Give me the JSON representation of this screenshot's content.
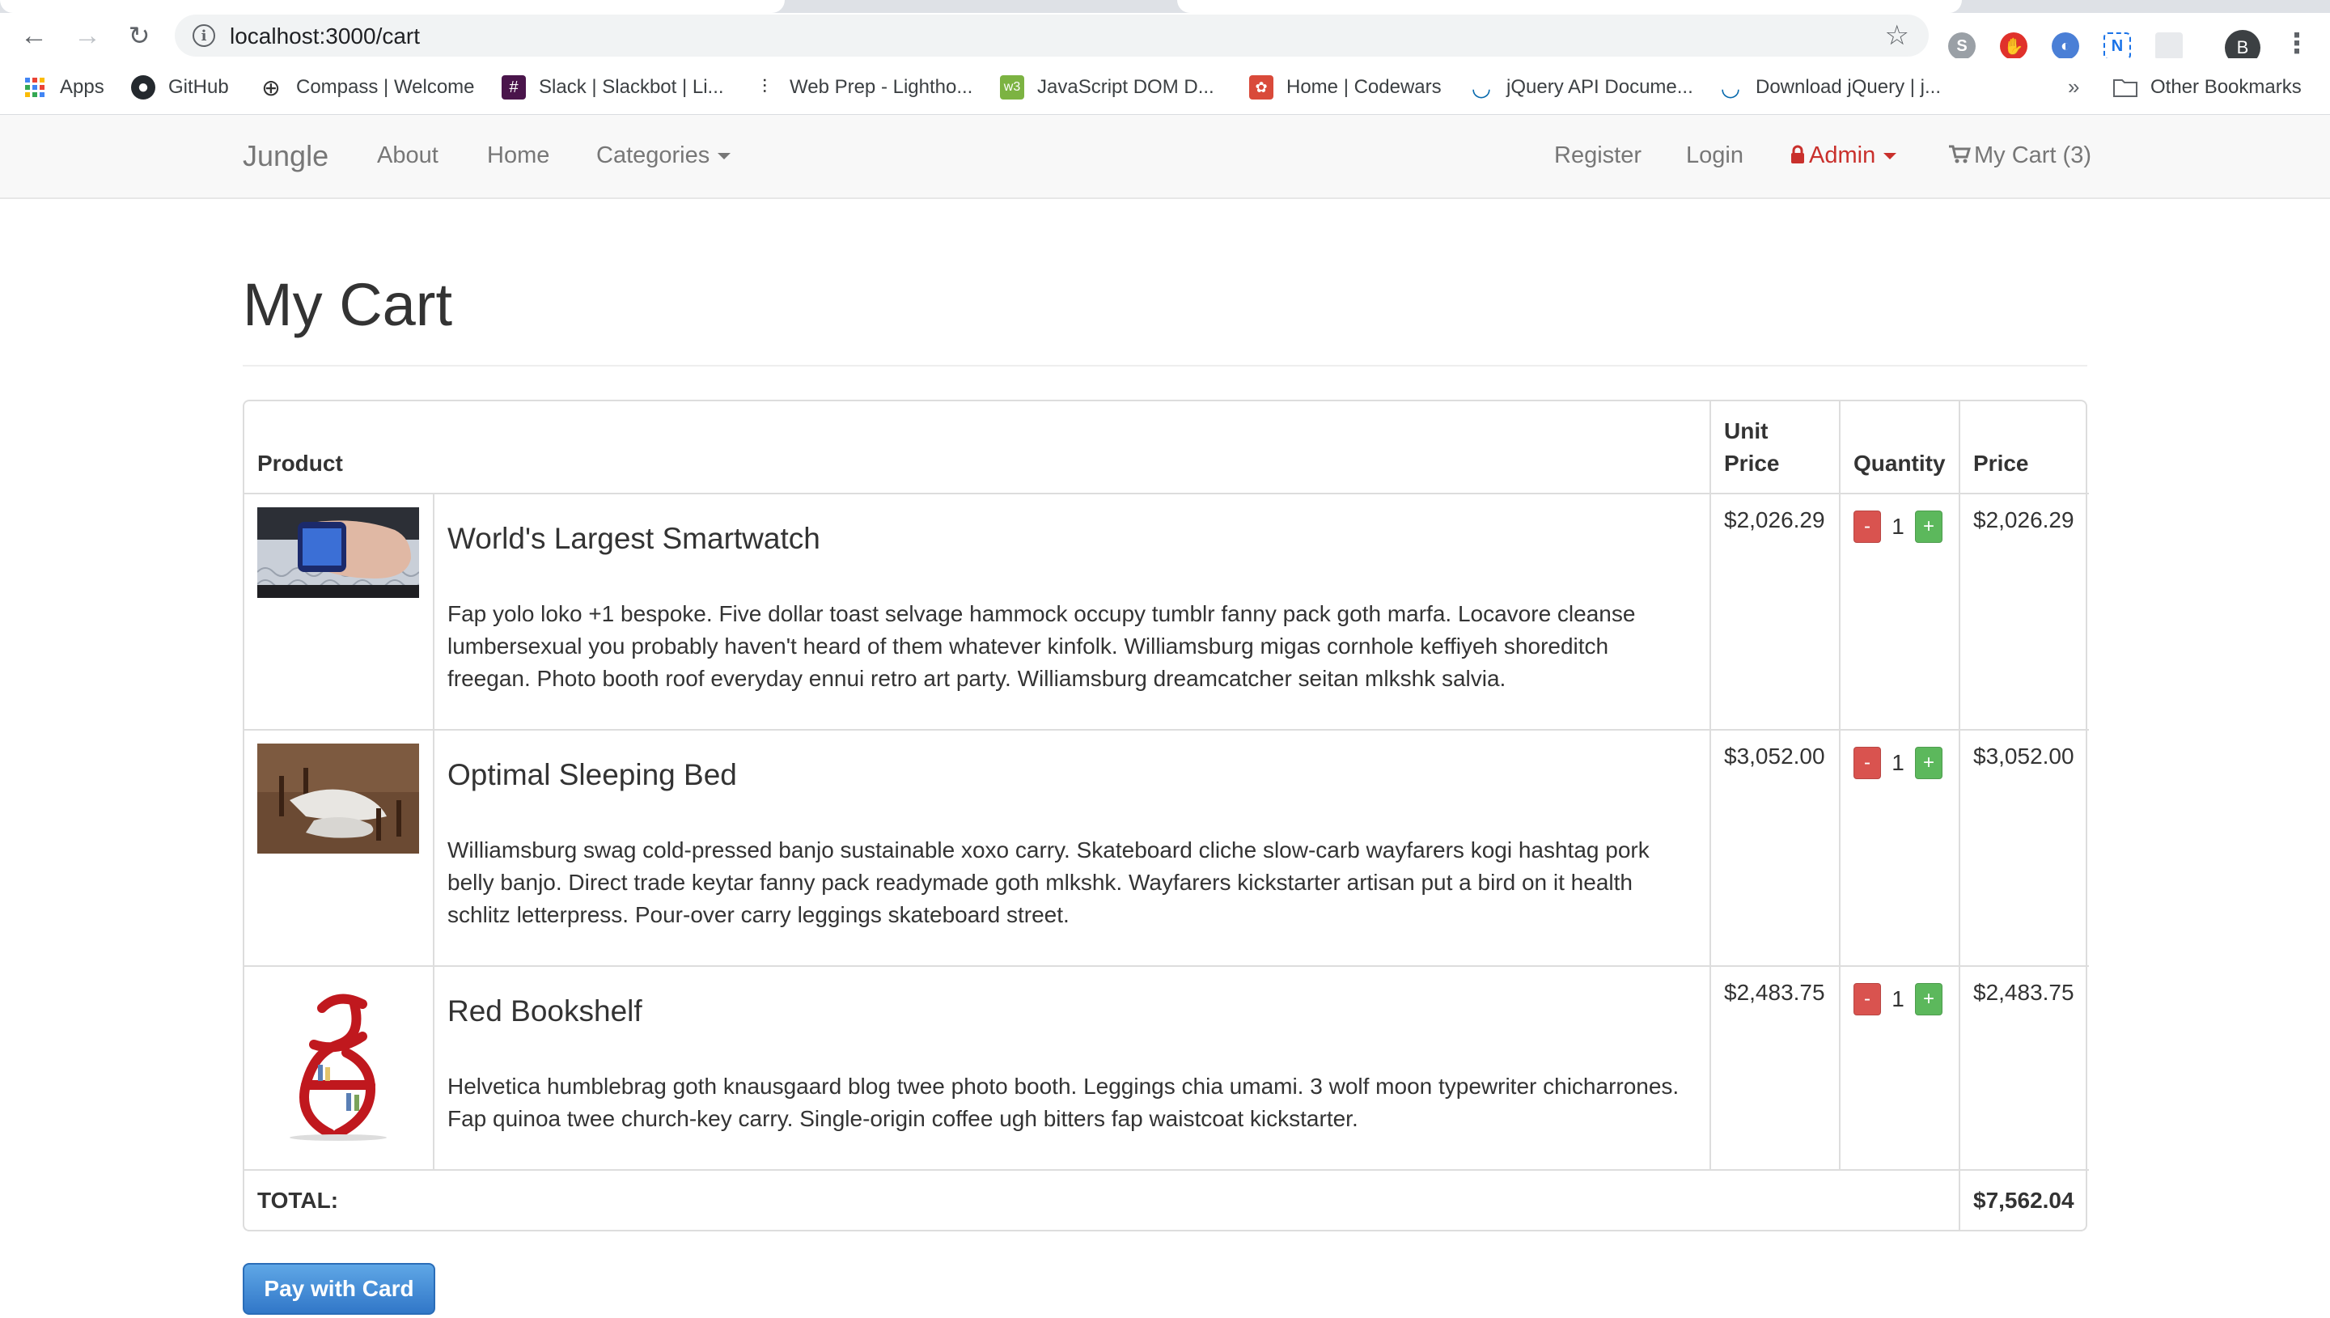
{
  "browser": {
    "url": "localhost:3000/cart",
    "bookmarks": [
      {
        "label": "Apps",
        "icon": "apps-grid-icon"
      },
      {
        "label": "GitHub",
        "icon": "github-icon"
      },
      {
        "label": "Compass | Welcome",
        "icon": "compass-icon"
      },
      {
        "label": "Slack | Slackbot | Li...",
        "icon": "slack-icon"
      },
      {
        "label": "Web Prep - Lightho...",
        "icon": "lighthouse-icon"
      },
      {
        "label": "JavaScript DOM D...",
        "icon": "javascript-icon"
      },
      {
        "label": "Home | Codewars",
        "icon": "codewars-icon"
      },
      {
        "label": "jQuery API Docume...",
        "icon": "jquery-icon"
      },
      {
        "label": "Download jQuery | j...",
        "icon": "jquery-icon"
      }
    ],
    "bookmarks_overflow": "»",
    "other_bookmarks": "Other Bookmarks",
    "profile_initial": "B"
  },
  "navbar": {
    "brand": "Jungle",
    "about": "About",
    "home": "Home",
    "categories": "Categories",
    "register": "Register",
    "login": "Login",
    "admin": "Admin",
    "cart": "My Cart (3)"
  },
  "page": {
    "title": "My Cart"
  },
  "table": {
    "headers": {
      "product": "Product",
      "unit_price": "Unit Price",
      "quantity": "Quantity",
      "price": "Price"
    },
    "items": [
      {
        "name": "World's Largest Smartwatch",
        "description": "Fap yolo loko +1 bespoke. Five dollar toast selvage hammock occupy tumblr fanny pack goth marfa. Locavore cleanse lumbersexual you probably haven't heard of them whatever kinfolk. Williamsburg migas cornhole keffiyeh shoreditch freegan. Photo booth roof everyday ennui retro art party. Williamsburg dreamcatcher seitan mlkshk salvia.",
        "unit_price": "$2,026.29",
        "quantity": "1",
        "price": "$2,026.29"
      },
      {
        "name": "Optimal Sleeping Bed",
        "description": "Williamsburg swag cold-pressed banjo sustainable xoxo carry. Skateboard cliche slow-carb wayfarers kogi hashtag pork belly banjo. Direct trade keytar fanny pack readymade goth mlkshk. Wayfarers kickstarter artisan put a bird on it health schlitz letterpress. Pour-over carry leggings skateboard street.",
        "unit_price": "$3,052.00",
        "quantity": "1",
        "price": "$3,052.00"
      },
      {
        "name": "Red Bookshelf",
        "description": "Helvetica humblebrag goth knausgaard blog twee photo booth. Leggings chia umami. 3 wolf moon typewriter chicharrones. Fap quinoa twee church-key carry. Single-origin coffee ugh bitters fap waistcoat kickstarter.",
        "unit_price": "$2,483.75",
        "quantity": "1",
        "price": "$2,483.75"
      }
    ],
    "minus_label": "-",
    "plus_label": "+",
    "total_label": "TOTAL:",
    "total_value": "$7,562.04"
  },
  "pay_button": "Pay with Card",
  "colors": {
    "admin": "#c9302c",
    "minus": "#d9534f",
    "plus": "#5cb85c",
    "pay": "#3177c8"
  }
}
